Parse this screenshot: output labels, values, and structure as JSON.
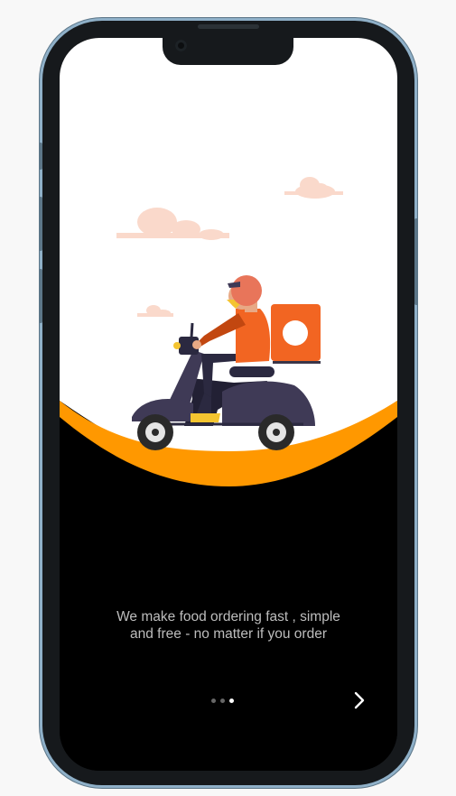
{
  "onboarding": {
    "message": "We make food ordering fast , simple and free - no matter if you order",
    "page_indicator": {
      "pages": 3,
      "active_page": 3
    },
    "next_icon": "chevron-right-icon",
    "illustration": "delivery-scooter-illustration"
  },
  "colors": {
    "accent": "#FF9800",
    "rider_orange": "#F26522",
    "background": "#000000",
    "cloud": "#FAD9CB"
  }
}
